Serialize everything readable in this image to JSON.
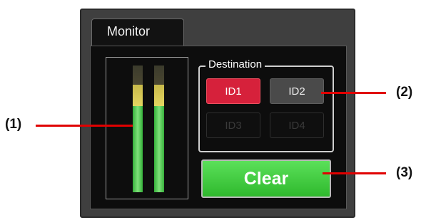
{
  "monitor": {
    "tab_label": "Monitor",
    "meter": {
      "channels": [
        {
          "name": "channel-1"
        },
        {
          "name": "channel-2"
        }
      ]
    },
    "destination": {
      "legend": "Destination",
      "buttons": [
        {
          "label": "ID1",
          "state": "active"
        },
        {
          "label": "ID2",
          "state": "normal"
        },
        {
          "label": "ID3",
          "state": "disabled"
        },
        {
          "label": "ID4",
          "state": "disabled"
        }
      ]
    },
    "clear_label": "Clear"
  },
  "callouts": [
    {
      "label": "(1)"
    },
    {
      "label": "(2)"
    },
    {
      "label": "(3)"
    }
  ],
  "colors": {
    "active_id": "#d6213b",
    "clear_button": "#3cc93a",
    "callout_line": "#e00000",
    "meter_green": "#35b13a",
    "meter_yellow": "#e4d661"
  }
}
